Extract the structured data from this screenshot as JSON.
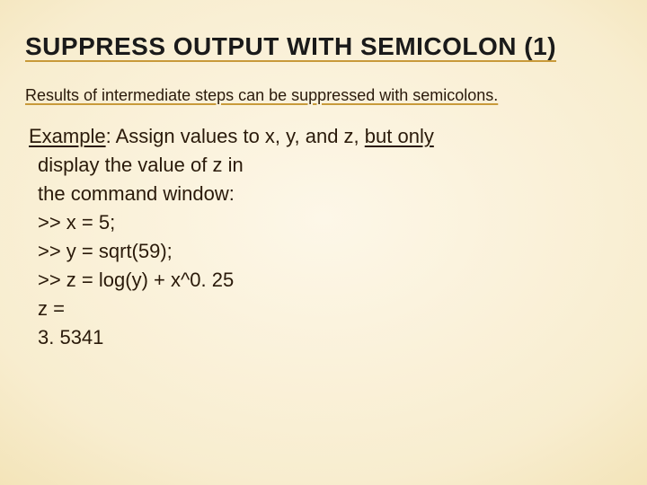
{
  "title": "SUPPRESS OUTPUT WITH SEMICOLON (1)",
  "intro": "Results of intermediate steps can be suppressed with semicolons.",
  "example": {
    "label": "Example",
    "line1_mid": ": Assign values to x, y, and z, ",
    "line1_end": "but only",
    "line2": "display the value of z in",
    "line3": "the command window:",
    "code1": ">> x = 5;",
    "code2": ">> y = sqrt(59);",
    "code3": ">> z = log(y) + x^0. 25",
    "out1": "z =",
    "out2": "3. 5341"
  }
}
